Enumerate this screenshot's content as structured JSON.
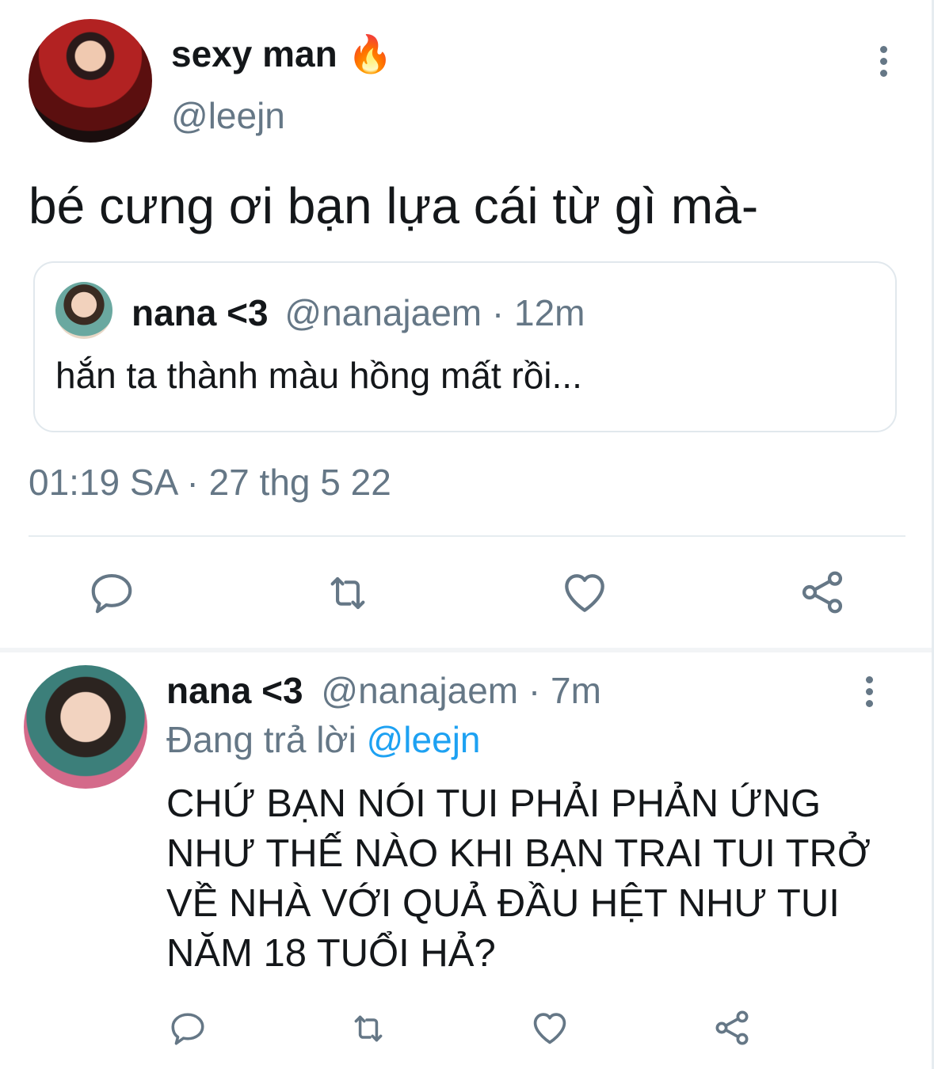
{
  "main_tweet": {
    "display_name": "sexy man",
    "emoji": "🔥",
    "handle": "@leejn",
    "text": "bé cưng ơi bạn lựa cái từ gì mà-",
    "quote": {
      "display_name": "nana <3",
      "handle": "@nanajaem",
      "separator": "·",
      "time": "12m",
      "text": "hắn ta thành màu hồng mất rồi..."
    },
    "timestamp": "01:19 SA · 27 thg 5 22",
    "actions": [
      "reply-icon",
      "retweet-icon",
      "like-icon",
      "share-icon"
    ]
  },
  "reply_tweet": {
    "display_name": "nana <3",
    "handle": "@nanajaem",
    "separator": "·",
    "time": "7m",
    "replying_prefix": "Đang trả lời",
    "replying_to": "@leejn",
    "text_lines": [
      "CHỨ BẠN NÓI TUI PHẢI PHẢN ỨNG",
      "NHƯ THẾ NÀO KHI BẠN TRAI TUI TRỞ",
      "VỀ NHÀ VỚI QUẢ ĐẦU HỆT NHƯ TUI",
      "NĂM 18 TUỔI HẢ?"
    ],
    "actions": [
      "reply-icon",
      "retweet-icon",
      "like-icon",
      "share-icon"
    ]
  },
  "colors": {
    "text": "#14171a",
    "muted": "#657786",
    "link": "#1da1f2",
    "border": "#e1e8ed",
    "fire": "#f4900c"
  }
}
